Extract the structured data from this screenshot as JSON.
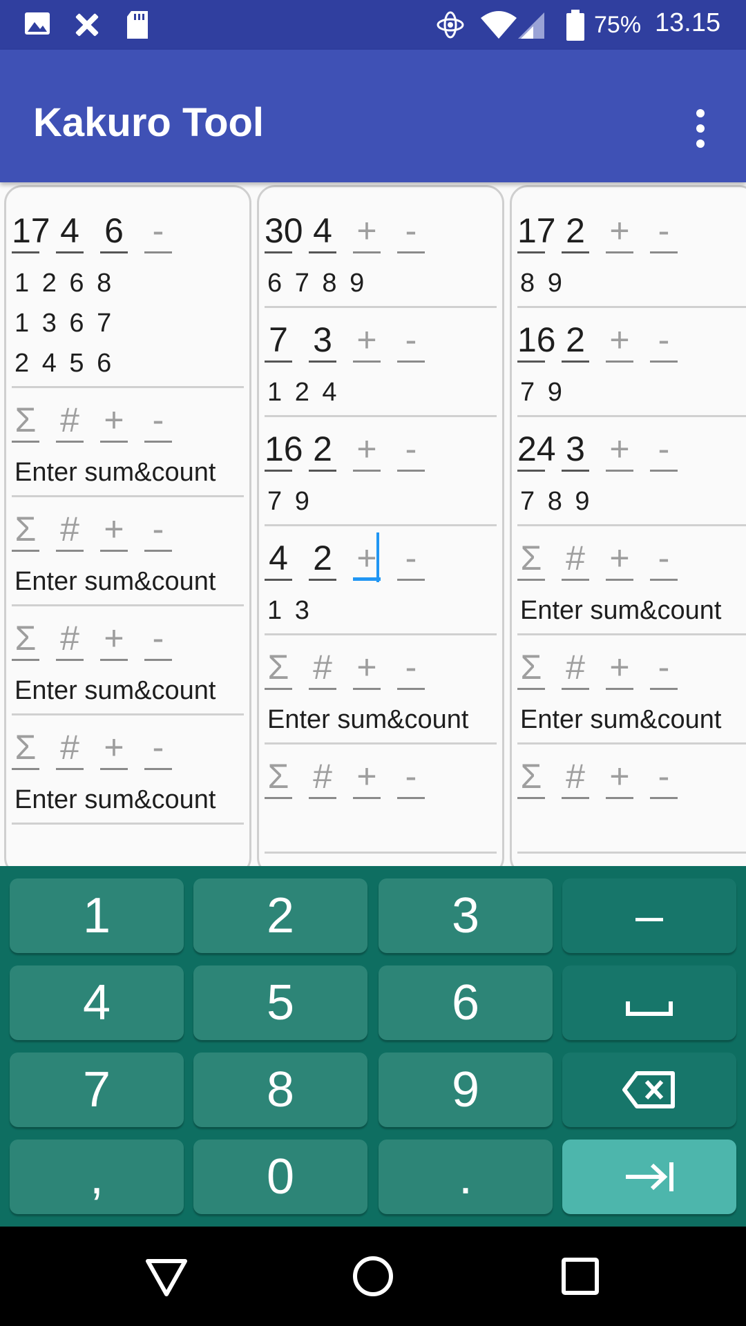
{
  "status_bar": {
    "battery": "75%",
    "time": "13.15",
    "icons": [
      "image-icon",
      "tools-icon",
      "sd-card-icon",
      "data-saver-icon",
      "wifi-icon",
      "signal-icon",
      "battery-icon"
    ]
  },
  "app_bar": {
    "title": "Kakuro Tool",
    "menu_icon": "more-vert-icon"
  },
  "columns": [
    {
      "clues": [
        {
          "sum": "17",
          "count": "4",
          "plus": "6",
          "minus": "-",
          "plus_hint": false,
          "combos": "1 2 6 8\n1 3 6 7\n2 4 5 6"
        },
        {
          "sum": "Σ",
          "count": "#",
          "plus": "+",
          "minus": "-",
          "empty": true,
          "combos": "Enter sum&count"
        },
        {
          "sum": "Σ",
          "count": "#",
          "plus": "+",
          "minus": "-",
          "empty": true,
          "combos": "Enter sum&count"
        },
        {
          "sum": "Σ",
          "count": "#",
          "plus": "+",
          "minus": "-",
          "empty": true,
          "combos": "Enter sum&count"
        },
        {
          "sum": "Σ",
          "count": "#",
          "plus": "+",
          "minus": "-",
          "empty": true,
          "combos": "Enter sum&count"
        }
      ]
    },
    {
      "clues": [
        {
          "sum": "30",
          "count": "4",
          "plus": "+",
          "minus": "-",
          "combos": "6 7 8 9"
        },
        {
          "sum": "7",
          "count": "3",
          "plus": "+",
          "minus": "-",
          "combos": "1 2 4"
        },
        {
          "sum": "16",
          "count": "2",
          "plus": "+",
          "minus": "-",
          "combos": "7 9"
        },
        {
          "sum": "4",
          "count": "2",
          "plus": "+",
          "minus": "-",
          "focused": true,
          "combos": "1 3"
        },
        {
          "sum": "Σ",
          "count": "#",
          "plus": "+",
          "minus": "-",
          "empty": true,
          "combos": "Enter sum&count"
        },
        {
          "sum": "Σ",
          "count": "#",
          "plus": "+",
          "minus": "-",
          "empty": true,
          "combos": ""
        }
      ]
    },
    {
      "clues": [
        {
          "sum": "17",
          "count": "2",
          "plus": "+",
          "minus": "-",
          "combos": "8 9"
        },
        {
          "sum": "16",
          "count": "2",
          "plus": "+",
          "minus": "-",
          "combos": "7 9"
        },
        {
          "sum": "24",
          "count": "3",
          "plus": "+",
          "minus": "-",
          "combos": "7 8 9"
        },
        {
          "sum": "Σ",
          "count": "#",
          "plus": "+",
          "minus": "-",
          "empty": true,
          "combos": "Enter sum&count"
        },
        {
          "sum": "Σ",
          "count": "#",
          "plus": "+",
          "minus": "-",
          "empty": true,
          "combos": "Enter sum&count"
        },
        {
          "sum": "Σ",
          "count": "#",
          "plus": "+",
          "minus": "-",
          "empty": true,
          "combos": ""
        }
      ]
    }
  ],
  "keyboard": {
    "rows": [
      [
        {
          "label": "1",
          "name": "key-1"
        },
        {
          "label": "2",
          "name": "key-2"
        },
        {
          "label": "3",
          "name": "key-3"
        },
        {
          "label": "–",
          "name": "key-minus",
          "func": true
        }
      ],
      [
        {
          "label": "4",
          "name": "key-4"
        },
        {
          "label": "5",
          "name": "key-5"
        },
        {
          "label": "6",
          "name": "key-6"
        },
        {
          "label": "",
          "name": "key-space",
          "func": true,
          "icon": "space-icon"
        }
      ],
      [
        {
          "label": "7",
          "name": "key-7"
        },
        {
          "label": "8",
          "name": "key-8"
        },
        {
          "label": "9",
          "name": "key-9"
        },
        {
          "label": "",
          "name": "key-backspace",
          "func": true,
          "icon": "backspace-icon"
        }
      ],
      [
        {
          "label": ",",
          "name": "key-comma"
        },
        {
          "label": "0",
          "name": "key-0"
        },
        {
          "label": ".",
          "name": "key-period"
        },
        {
          "label": "",
          "name": "key-next",
          "enter": true,
          "icon": "tab-next-icon"
        }
      ]
    ]
  },
  "nav_bar": {
    "icons": [
      "back-icon",
      "home-icon",
      "recents-icon"
    ]
  },
  "colors": {
    "status_bar": "#303f9f",
    "app_bar": "#3f51b5",
    "keyboard": "#0e6e61",
    "key": "#2d8577",
    "enter_key": "#4db6ac",
    "focus": "#2196f3"
  }
}
